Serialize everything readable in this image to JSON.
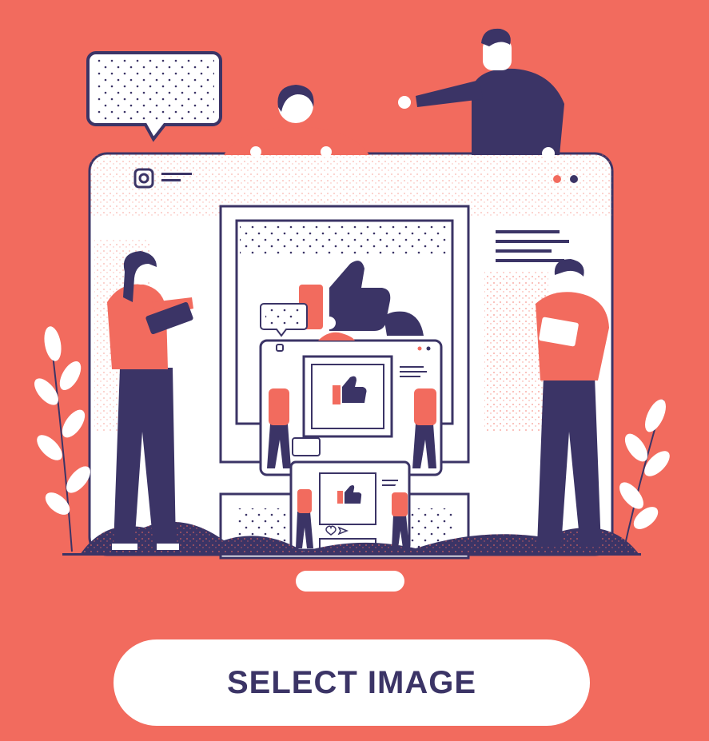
{
  "illustration": {
    "subject": "social-media-feed-illustration",
    "colors": {
      "background": "#F26B5E",
      "ink": "#3B3466",
      "paper": "#FFFFFF",
      "accent": "#F26B5E"
    },
    "icons": [
      "camera-icon",
      "thumbs-up-icon",
      "speech-bubble-icon",
      "heart-icon",
      "send-icon"
    ]
  },
  "actions": {
    "select_image_label": "SELECT IMAGE"
  }
}
